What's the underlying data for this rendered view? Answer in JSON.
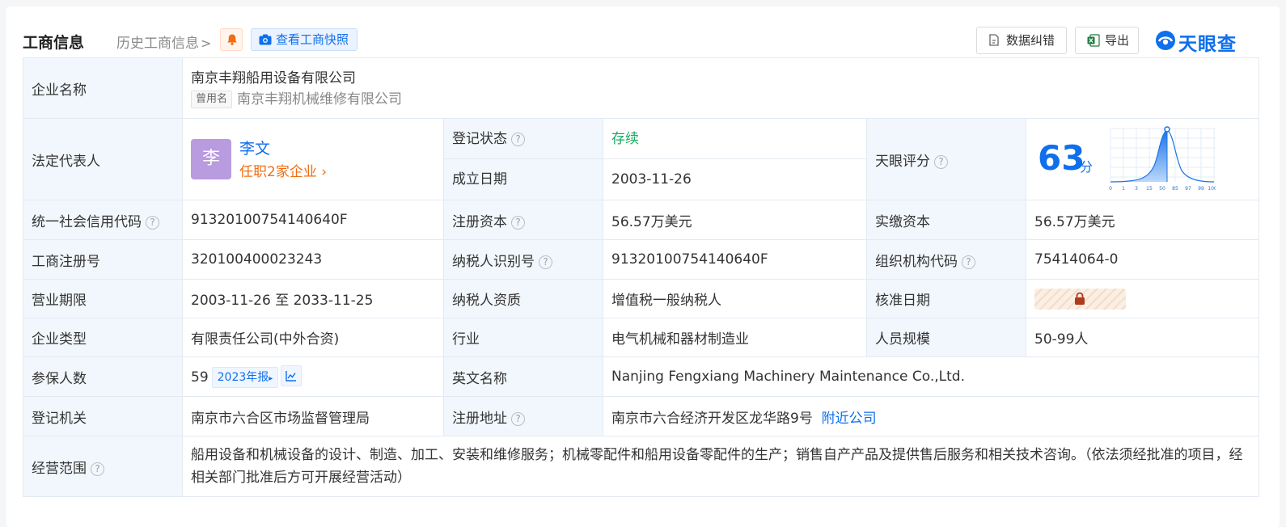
{
  "header": {
    "title": "工商信息",
    "history": "历史工商信息",
    "snapshot_btn": "查看工商快照",
    "correct_btn": "数据纠错",
    "export_btn": "导出",
    "logo": "天眼查"
  },
  "company": {
    "name_label": "企业名称",
    "name": "南京丰翔船用设备有限公司",
    "former_tag": "曾用名",
    "former_name": "南京丰翔机械维修有限公司",
    "legal_label": "法定代表人",
    "avatar_char": "李",
    "legal_name": "李文",
    "legal_link": "任职2家企业",
    "status_label": "登记状态",
    "status": "存续",
    "found_label": "成立日期",
    "found_date": "2003-11-26",
    "score_label": "天眼评分",
    "score": "63",
    "score_unit": "分",
    "score_ticks": [
      "0",
      "1",
      "3",
      "15",
      "50",
      "85",
      "97",
      "99",
      "100"
    ],
    "credit_label": "统一社会信用代码",
    "credit_code": "91320100754140640F",
    "capital_label": "注册资本",
    "capital": "56.57万美元",
    "paid_label": "实缴资本",
    "paid": "56.57万美元",
    "reg_no_label": "工商注册号",
    "reg_no": "320100400023243",
    "tax_id_label": "纳税人识别号",
    "tax_id": "91320100754140640F",
    "org_code_label": "组织机构代码",
    "org_code": "75414064-0",
    "term_label": "营业期限",
    "term": "2003-11-26 至 2033-11-25",
    "tax_qual_label": "纳税人资质",
    "tax_qual": "增值税一般纳税人",
    "approve_label": "核准日期",
    "type_label": "企业类型",
    "type": "有限责任公司(中外合资)",
    "industry_label": "行业",
    "industry": "电气机械和器材制造业",
    "staff_label": "人员规模",
    "staff": "50-99人",
    "insured_label": "参保人数",
    "insured": "59",
    "insured_year": "2023年报",
    "en_label": "英文名称",
    "en_name": "Nanjing Fengxiang Machinery Maintenance Co.,Ltd.",
    "authority_label": "登记机关",
    "authority": "南京市六合区市场监督管理局",
    "address_label": "注册地址",
    "address": "南京市六合经济开发区龙华路9号",
    "nearby": "附近公司",
    "scope_label": "经营范围",
    "scope": "船用设备和机械设备的设计、制造、加工、安装和维修服务；机械零配件和船用设备零配件的生产；销售自产产品及提供售后服务和相关技术咨询。（依法须经批准的项目，经相关部门批准后方可开展经营活动）"
  },
  "colors": {
    "accent": "#0f6fec",
    "status_green": "#1aa861",
    "link_orange": "#f26d10",
    "label_bg": "#f2f7fd"
  }
}
